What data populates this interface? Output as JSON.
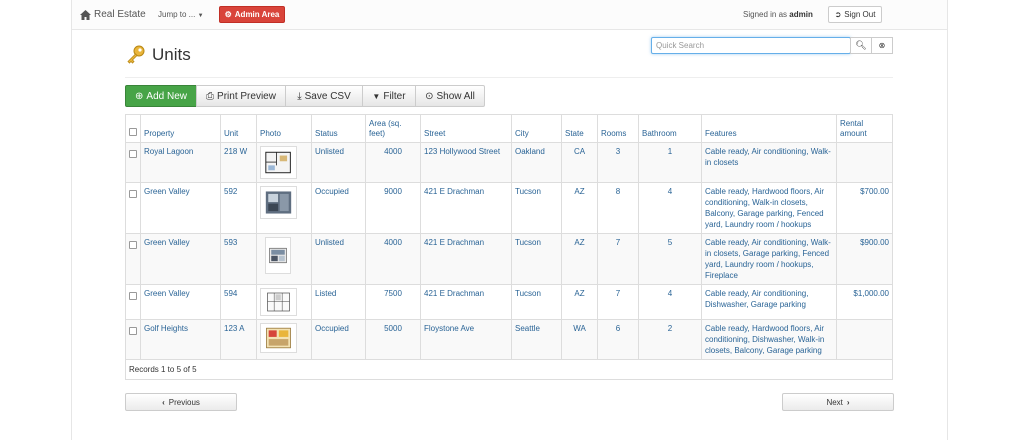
{
  "navbar": {
    "brand": "Real Estate",
    "jump": "Jump to ...",
    "admin_label": "Admin Area",
    "signed_prefix": "Signed in as",
    "signed_user": "admin",
    "signout_label": "Sign Out"
  },
  "page_title": "Units",
  "search": {
    "placeholder": "Quick Search",
    "value": ""
  },
  "toolbar": {
    "add_new": "Add New",
    "print_preview": "Print Preview",
    "save_csv": "Save CSV",
    "filter": "Filter",
    "show_all": "Show All"
  },
  "table": {
    "headers": [
      "Property",
      "Unit",
      "Photo",
      "Status",
      "Area (sq. feet)",
      "Street",
      "City",
      "State",
      "Rooms",
      "Bathroom",
      "Features",
      "Rental amount"
    ],
    "rows": [
      {
        "property": "Royal Lagoon",
        "unit": "218 W",
        "status": "Unlisted",
        "area": "4000",
        "street": "123 Hollywood Street",
        "city": "Oakland",
        "state": "CA",
        "rooms": "3",
        "bathroom": "1",
        "features": "Cable ready, Air conditioning, Walk-in closets",
        "rental": ""
      },
      {
        "property": "Green Valley",
        "unit": "592",
        "status": "Occupied",
        "area": "9000",
        "street": "421 E Drachman",
        "city": "Tucson",
        "state": "AZ",
        "rooms": "8",
        "bathroom": "4",
        "features": "Cable ready, Hardwood floors, Air conditioning, Walk-in closets, Balcony, Garage parking, Fenced yard, Laundry room / hookups",
        "rental": "$700.00"
      },
      {
        "property": "Green Valley",
        "unit": "593",
        "status": "Unlisted",
        "area": "4000",
        "street": "421 E Drachman",
        "city": "Tucson",
        "state": "AZ",
        "rooms": "7",
        "bathroom": "5",
        "features": "Cable ready, Air conditioning, Walk-in closets, Garage parking, Fenced yard, Laundry room / hookups, Fireplace",
        "rental": "$900.00"
      },
      {
        "property": "Green Valley",
        "unit": "594",
        "status": "Listed",
        "area": "7500",
        "street": "421 E Drachman",
        "city": "Tucson",
        "state": "AZ",
        "rooms": "7",
        "bathroom": "4",
        "features": "Cable ready, Air conditioning, Dishwasher, Garage parking",
        "rental": "$1,000.00"
      },
      {
        "property": "Golf Heights",
        "unit": "123 A",
        "status": "Occupied",
        "area": "5000",
        "street": "Floystone Ave",
        "city": "Seattle",
        "state": "WA",
        "rooms": "6",
        "bathroom": "2",
        "features": "Cable ready, Hardwood floors, Air conditioning, Dishwasher, Walk-in closets, Balcony, Garage parking",
        "rental": ""
      }
    ],
    "records": "Records 1 to 5 of 5"
  },
  "pager": {
    "previous": "Previous",
    "next": "Next"
  },
  "colors": {
    "link": "#2a6496",
    "admin": "#d9443a",
    "add_new": "#47a447"
  }
}
